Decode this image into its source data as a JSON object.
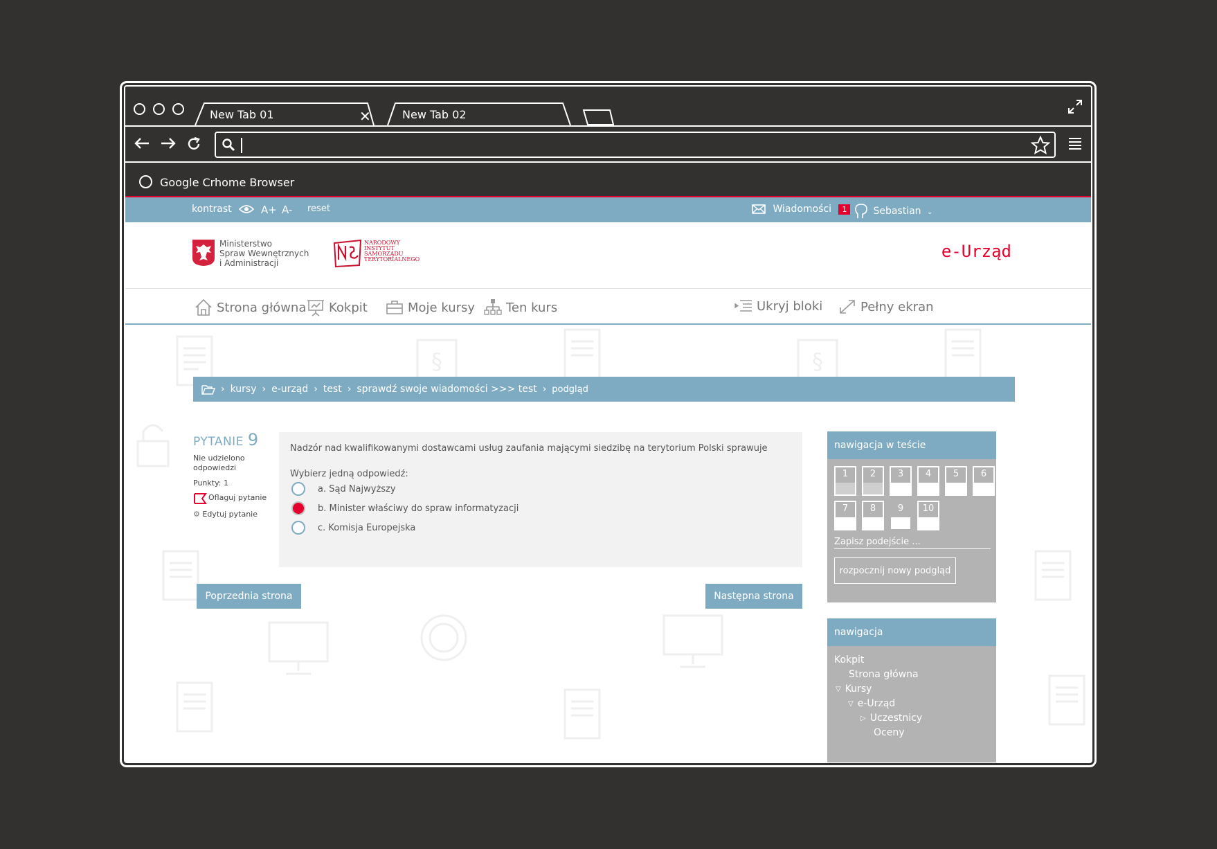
{
  "browser": {
    "tabs": [
      {
        "label": "New Tab 01"
      },
      {
        "label": "New Tab 02"
      }
    ],
    "bookmark_label": "Google Crhome Browser"
  },
  "topbar": {
    "contrast_label": "kontrast",
    "font_increase": "A+",
    "font_decrease": "A-",
    "reset_label": "reset",
    "messages_label": "Wiadomości",
    "messages_count": "1",
    "user_name": "Sebastian"
  },
  "header": {
    "mswia_lines": [
      "Ministerstwo",
      "Spraw Wewnętrznych",
      "i Administracji"
    ],
    "nist_lines": [
      "NARODOWY",
      "INSTYTUT",
      "SAMORZĄDU",
      "TERYTORIALNEGO"
    ],
    "brand": "e-Urząd"
  },
  "mainnav": {
    "items": [
      {
        "label": "Strona główna",
        "icon": "home-icon"
      },
      {
        "label": "Kokpit",
        "icon": "presentation-icon"
      },
      {
        "label": "Moje kursy",
        "icon": "briefcase-icon"
      },
      {
        "label": "Ten kurs",
        "icon": "hierarchy-icon"
      }
    ],
    "hide_blocks": "Ukryj bloki",
    "fullscreen": "Pełny ekran"
  },
  "breadcrumb": {
    "items": [
      "kursy",
      "e-urząd",
      "test",
      "sprawdź swoje wiadomości >>> test",
      "podgląd"
    ]
  },
  "question": {
    "title_word": "PYTANIE",
    "number": "9",
    "status": "Nie udzielono odpowiedzi",
    "points": "Punkty: 1",
    "flag_label": "Oflaguj pytanie",
    "edit_label": "Edytuj pytanie",
    "text": "Nadzór nad kwalifikowanymi dostawcami usług zaufania mającymi siedzibę na terytorium Polski sprawuje",
    "prompt": "Wybierz jedną odpowiedź:",
    "answers": [
      {
        "label": "a. Sąd Najwyższy",
        "selected": false
      },
      {
        "label": "b. Minister właściwy do spraw informatyzacji",
        "selected": true
      },
      {
        "label": "c. Komisja Europejska",
        "selected": false
      }
    ]
  },
  "buttons": {
    "prev": "Poprzednia strona",
    "next": "Następna strona"
  },
  "quiz_nav": {
    "title": "nawigacja w teście",
    "cells": [
      "1",
      "2",
      "3",
      "4",
      "5",
      "6",
      "7",
      "8",
      "9",
      "10"
    ],
    "answered": [
      "1",
      "2"
    ],
    "save_label": "Zapisz podejście ...",
    "new_preview": "rozpocznij nowy podgląd"
  },
  "nav_block": {
    "title": "nawigacja",
    "items": [
      "Kokpit",
      "Strona główna",
      "Kursy",
      "e-Urząd",
      "Uczestnicy",
      "Oceny"
    ]
  },
  "colors": {
    "accent": "#7fabc2",
    "brand_red": "#e6002e",
    "block_gray": "#b3b3b3"
  }
}
